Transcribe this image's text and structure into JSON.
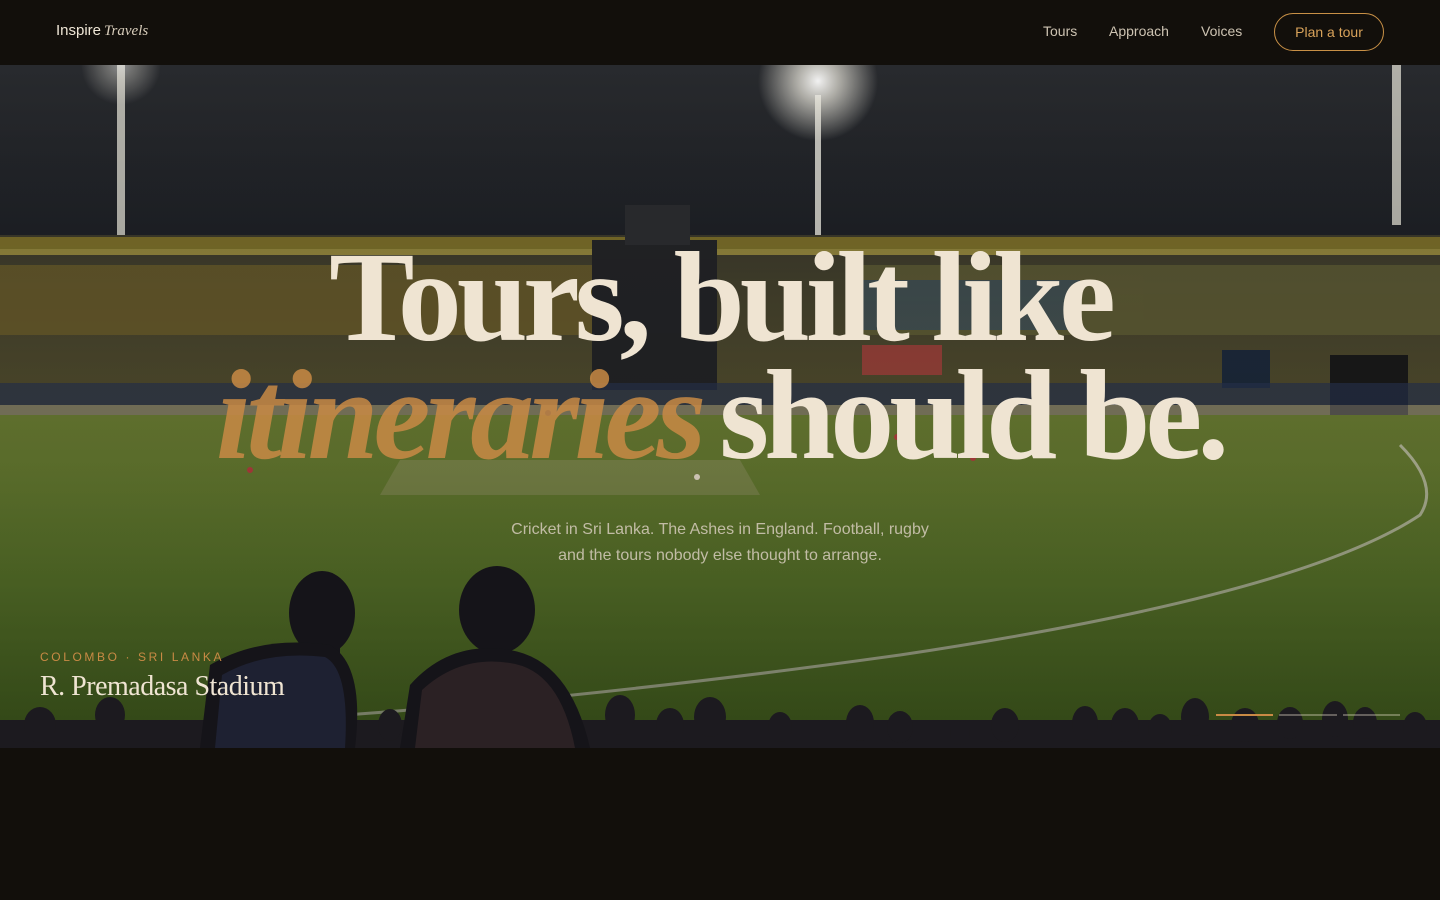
{
  "brand": {
    "name": "Inspire",
    "accent": "Travels"
  },
  "nav": {
    "items": [
      {
        "label": "Tours"
      },
      {
        "label": "Approach"
      },
      {
        "label": "Voices"
      }
    ],
    "cta": "Plan a tour"
  },
  "hero": {
    "headline_line1": "Tours, built like",
    "headline_accent": "itineraries",
    "headline_rest": "should be.",
    "subtitle_line1": "Cricket in Sri Lanka. The Ashes in England. Football, rugby",
    "subtitle_line2": "and the tours nobody else thought to arrange.",
    "location_eyebrow": "COLOMBO · SRI LANKA",
    "location_name": "R. Premadasa Stadium",
    "slides_total": 3,
    "slide_active": 1
  },
  "colors": {
    "background": "#120f0b",
    "accent": "#c98a45",
    "text": "#efe4d2",
    "pitch": "#5f7a2e",
    "sky": "#1c1f24"
  }
}
